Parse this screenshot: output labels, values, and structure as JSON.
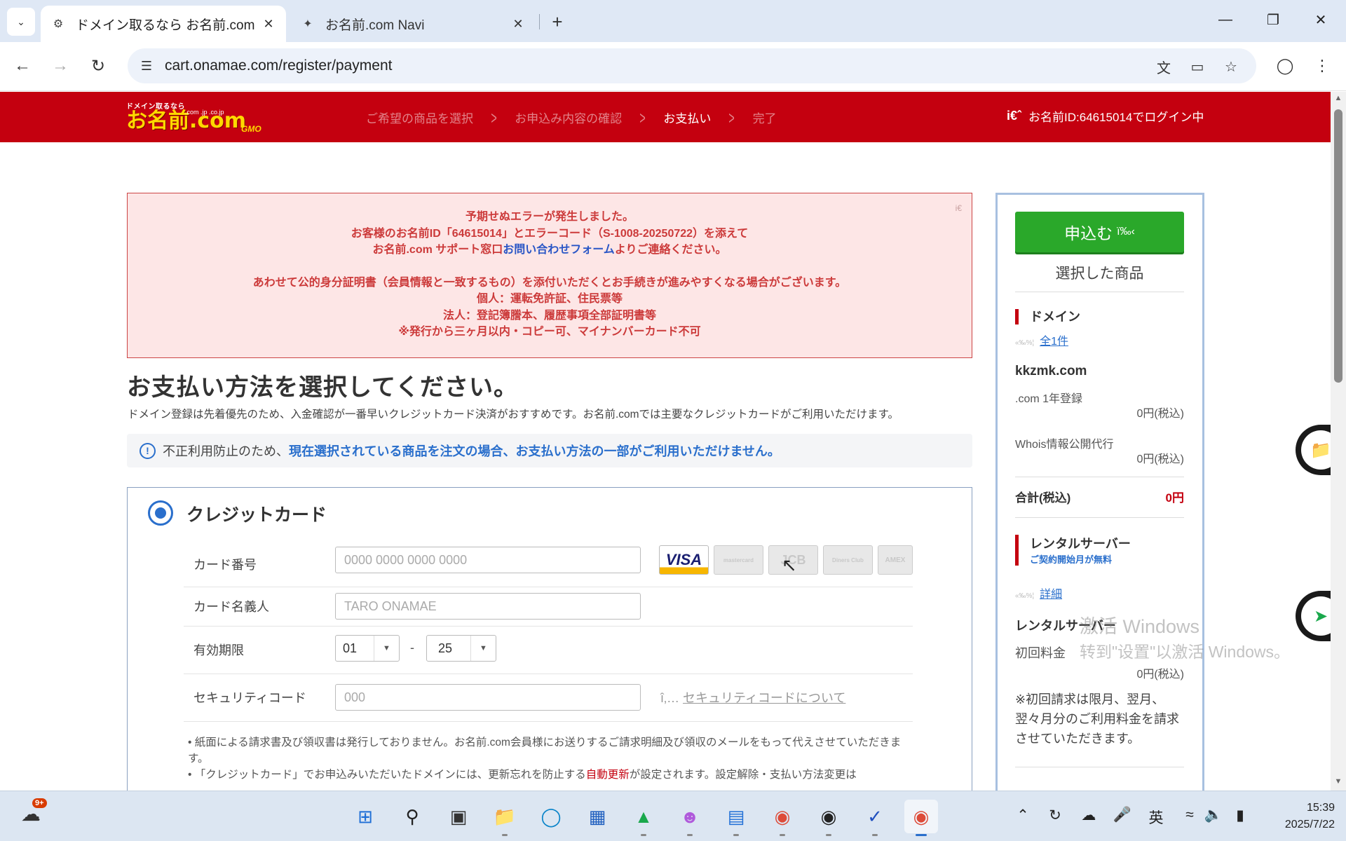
{
  "browser": {
    "tabs": [
      {
        "title": "ドメイン取るなら お名前.com",
        "favicon": "gear-icon",
        "active": true
      },
      {
        "title": "お名前.com Navi",
        "favicon": "pin-icon",
        "active": false
      }
    ],
    "url": "cart.onamae.com/register/payment"
  },
  "header": {
    "logo_small": "ドメイン取るなら",
    "logo_main": "お名前.com",
    "logo_tlds": ".com .jp .co.jp",
    "logo_gmo": "GMO",
    "steps": [
      "ご希望の商品を選択",
      "お申込み内容の確認",
      "お支払い",
      "完了"
    ],
    "current_step": 2,
    "login_icon": "i€ˆ",
    "login_text": "お名前ID:64615014でログイン中"
  },
  "error": {
    "line1": "予期せぬエラーが発生しました。",
    "line2": "お客様のお名前ID「64615014」とエラーコード（S-1008-20250722）を添えて",
    "line3_pre": "お名前.com サポート窓口",
    "line3_link": "お問い合わせフォーム",
    "line3_post": "よりご連絡ください。",
    "line4": "あわせて公的身分証明書（会員情報と一致するもの）を添付いただくとお手続きが進みやすくなる場合がございます。",
    "line5": "個人：運転免許証、住民票等",
    "line6": "法人：登記簿謄本、履歴事項全部証明書等",
    "line7": "※発行から三ヶ月以内・コピー可、マイナンバーカード不可",
    "close_glyph": "i€"
  },
  "main": {
    "title": "お支払い方法を選択してください。",
    "lead": "ドメイン登録は先着優先のため、入金確認が一番早いクレジットカード決済がおすすめです。お名前.comでは主要なクレジットカードがご利用いただけます。",
    "notice_plain": "不正利用防止のため、",
    "notice_blue": "現在選択されている商品を注文の場合、お支払い方法の一部がご利用いただけません。",
    "notice_icon": "!"
  },
  "payment": {
    "method_title": "クレジットカード",
    "card_number_label": "カード番号",
    "card_number_placeholder": "0000 0000 0000 0000",
    "card_logos": [
      "VISA",
      "mastercard",
      "JCB",
      "Diners Club",
      "AMEX"
    ],
    "card_holder_label": "カード名義人",
    "card_holder_placeholder": "TARO ONAMAE",
    "expiry_label": "有効期限",
    "expiry_month": "01",
    "expiry_dash": "-",
    "expiry_year": "25",
    "cvc_label": "セキュリティコード",
    "cvc_placeholder": "000",
    "cvc_link_prefix": "î‚…",
    "cvc_link": "セキュリティコードについて",
    "note1": "紙面による請求書及び領収書は発行しておりません。お名前.com会員様にお送りするご請求明細及び領収のメールをもって代えさせていただきます。",
    "note2_pre": "「クレジットカード」でお申込みいただいたドメインには、更新忘れを防止する",
    "note2_red": "自動更新",
    "note2_post": "が設定されます。設定解除・支払い方法変更は"
  },
  "sidebar": {
    "apply_label": "申込む",
    "apply_tail": "ï‰‹",
    "selected_title": "選択した商品",
    "domain_section": "ドメイン",
    "domain_link_glyph": "«‰%¦",
    "domain_count_link": "全1件",
    "domain_name": "kkzmk.com",
    "domain_plan": ".com 1年登録",
    "domain_price": "0円(税込)",
    "whois_label": "Whois情報公開代行",
    "whois_price": "0円(税込)",
    "total_label": "合計(税込)",
    "total_value": "0円",
    "rental_section": "レンタルサーバー",
    "rental_sub": "ご契約開始月が無料",
    "rental_link_glyph": "«‰%¦",
    "rental_detail_link": "詳細",
    "rental_name": "レンタルサーバー",
    "initial_fee_label": "初回料金",
    "initial_fee_price": "0円(税込)",
    "rental_note": "※初回請求は限月、翌月、翌々月分のご利用料金を請求させていただきます。"
  },
  "watermark": {
    "line1": "激活 Windows",
    "line2": "转到\"设置\"以激活 Windows。"
  },
  "taskbar": {
    "weather_badge": "9+",
    "ime_label": "英",
    "time": "15:39",
    "date": "2025/7/22"
  },
  "colors": {
    "brand_red": "#c4000f",
    "accent_blue": "#2a6fcc",
    "apply_green": "#2aa82a",
    "error_bg": "#fde6e6"
  }
}
